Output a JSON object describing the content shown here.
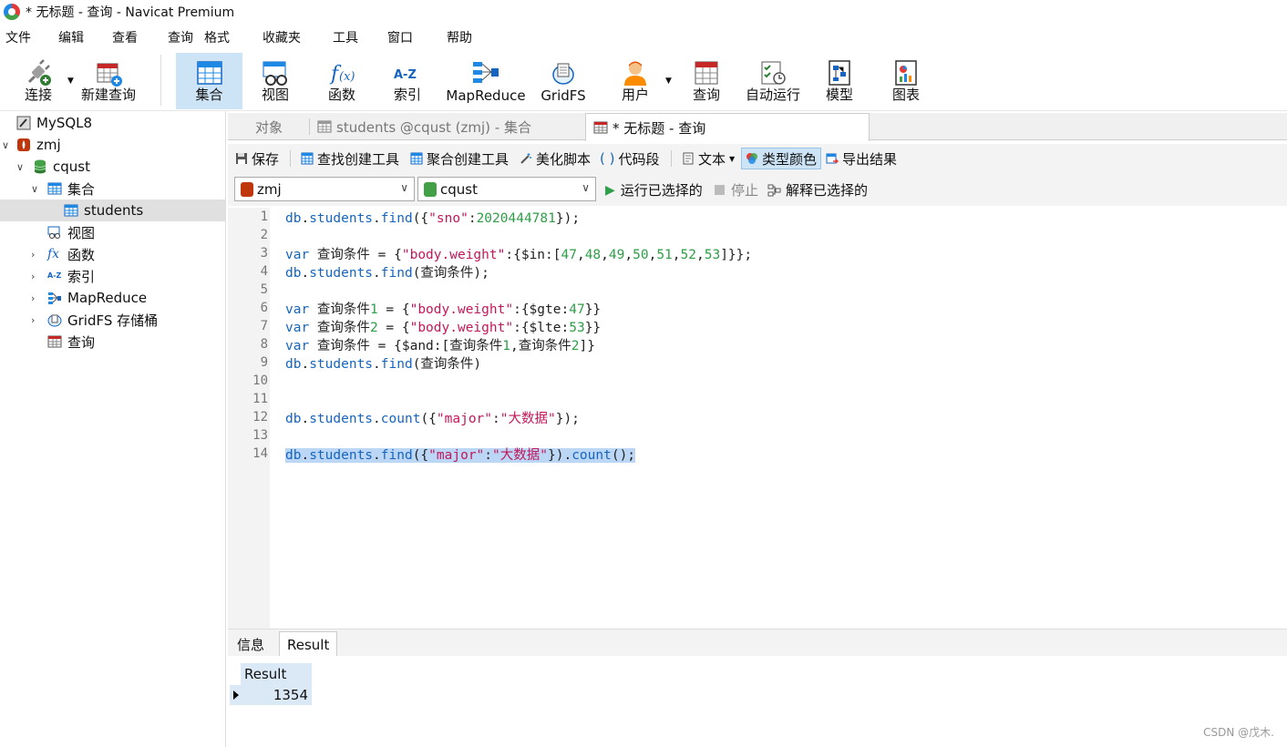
{
  "window": {
    "title": "* 无标题 - 查询 - Navicat Premium"
  },
  "menu": [
    "文件",
    "编辑",
    "查看",
    "查询",
    "格式",
    "收藏夹",
    "工具",
    "窗口",
    "帮助"
  ],
  "toolbar": {
    "connect": "连接",
    "new_query": "新建查询",
    "collection": "集合",
    "view": "视图",
    "function": "函数",
    "index": "索引",
    "mapreduce": "MapReduce",
    "gridfs": "GridFS",
    "user": "用户",
    "query": "查询",
    "auto_run": "自动运行",
    "model": "模型",
    "chart": "图表"
  },
  "sidebar": {
    "items": [
      {
        "label": "MySQL8"
      },
      {
        "label": "zmj"
      },
      {
        "label": "cqust"
      },
      {
        "label": "集合"
      },
      {
        "label": "students"
      },
      {
        "label": "视图"
      },
      {
        "label": "函数"
      },
      {
        "label": "索引"
      },
      {
        "label": "MapReduce"
      },
      {
        "label": "GridFS 存储桶"
      },
      {
        "label": "查询"
      }
    ]
  },
  "tabs": {
    "objects": "对象",
    "students": "students @cqust (zmj) - 集合",
    "query": "* 无标题 - 查询"
  },
  "query_toolbar": {
    "save": "保存",
    "find_builder": "查找创建工具",
    "aggregate_builder": "聚合创建工具",
    "beautify": "美化脚本",
    "snippet": "代码段",
    "text": "文本",
    "type_color": "类型颜色",
    "export": "导出结果"
  },
  "selectors": {
    "connection": "zmj",
    "database": "cqust",
    "run_selected": "运行已选择的",
    "stop": "停止",
    "explain": "解释已选择的"
  },
  "editor": {
    "line_numbers": [
      "1",
      "2",
      "3",
      "4",
      "5",
      "6",
      "7",
      "8",
      "9",
      "10",
      "11",
      "12",
      "13",
      "14"
    ],
    "lines": [
      "db.students.find({\"sno\":2020444781});",
      "",
      "var 查询条件 = {\"body.weight\":{$in:[47,48,49,50,51,52,53]}};",
      "db.students.find(查询条件);",
      "",
      "var 查询条件1 = {\"body.weight\":{$gte:47}}",
      "var 查询条件2 = {\"body.weight\":{$lte:53}}",
      "var 查询条件 = {$and:[查询条件1,查询条件2]}",
      "db.students.find(查询条件)",
      "",
      "",
      "db.students.count({\"major\":\"大数据\"});",
      "",
      "db.students.find({\"major\":\"大数据\"}).count();"
    ]
  },
  "bottom_tabs": {
    "info": "信息",
    "result": "Result"
  },
  "result": {
    "column": "Result",
    "value": "1354"
  },
  "watermark": "CSDN @戊木."
}
